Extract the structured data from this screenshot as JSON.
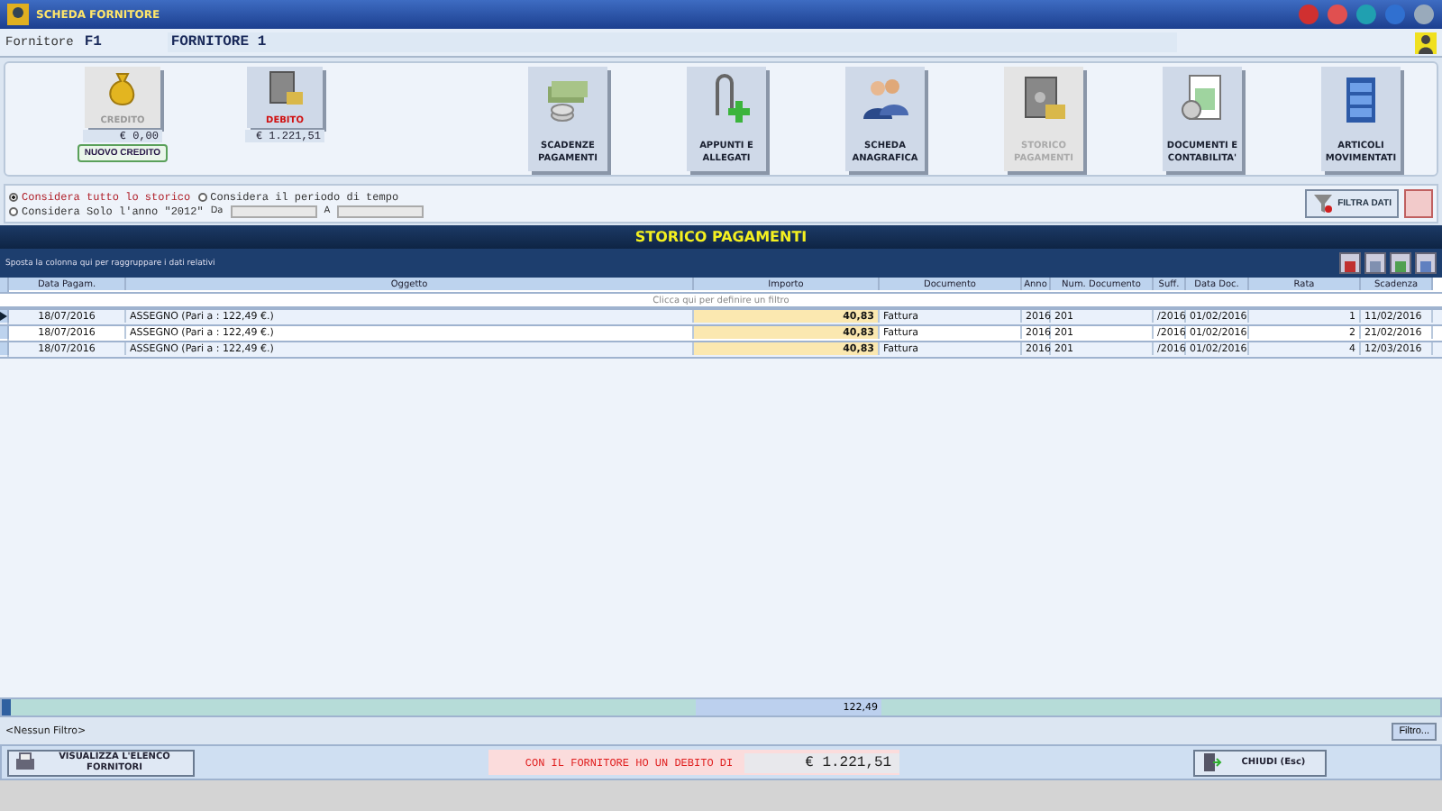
{
  "window": {
    "title": "SCHEDA FORNITORE"
  },
  "header": {
    "label": "Fornitore",
    "code": "F1",
    "name": "FORNITORE 1"
  },
  "toolbar": {
    "credit": {
      "label": "CREDITO",
      "amount": "€ 0,00",
      "action": "NUOVO CREDITO"
    },
    "debit": {
      "label": "DEBITO",
      "amount": "€ 1.221,51"
    },
    "buttons": [
      {
        "label": "SCADENZE PAGAMENTI",
        "selected": false
      },
      {
        "label": "APPUNTI E ALLEGATI",
        "selected": false
      },
      {
        "label": "SCHEDA ANAGRAFICA",
        "selected": false
      },
      {
        "label": "STORICO PAGAMENTI",
        "selected": true
      },
      {
        "label": "DOCUMENTI E CONTABILITA'",
        "selected": false
      },
      {
        "label": "ARTICOLI MOVIMENTATI",
        "selected": false
      }
    ]
  },
  "filters": {
    "options": [
      {
        "label": "Considera tutto lo storico",
        "selected": true
      },
      {
        "label": "Considera il periodo di tempo",
        "selected": false
      },
      {
        "label": "Considera Solo l'anno \"2012\"",
        "selected": false
      }
    ],
    "from_label": "Da",
    "to_label": "A",
    "filter_button": "FILTRA DATI"
  },
  "grid": {
    "title": "STORICO PAGAMENTI",
    "group_hint": "Sposta la colonna qui per raggruppare i dati relativi",
    "columns": [
      "Data Pagam.",
      "Oggetto",
      "Importo",
      "Documento",
      "Anno",
      "Num. Documento",
      "Suff.",
      "Data Doc.",
      "Rata",
      "Scadenza"
    ],
    "filter_hint": "Clicca qui per definire un filtro",
    "rows": [
      {
        "selected": true,
        "cells": [
          "18/07/2016",
          "ASSEGNO (Pari a : 122,49 €.)",
          "40,83",
          "Fattura",
          "2016",
          "201",
          "/2016",
          "01/02/2016",
          "1",
          "11/02/2016"
        ]
      },
      {
        "selected": false,
        "cells": [
          "18/07/2016",
          "ASSEGNO (Pari a : 122,49 €.)",
          "40,83",
          "Fattura",
          "2016",
          "201",
          "/2016",
          "01/02/2016",
          "2",
          "21/02/2016"
        ]
      },
      {
        "selected": false,
        "cells": [
          "18/07/2016",
          "ASSEGNO (Pari a : 122,49 €.)",
          "40,83",
          "Fattura",
          "2016",
          "201",
          "/2016",
          "01/02/2016",
          "4",
          "12/03/2016"
        ]
      }
    ],
    "total": "122,49",
    "filter_status": "<Nessun Filtro>",
    "filter_button": "Filtro..."
  },
  "footer": {
    "list_button": "VISUALIZZA L'ELENCO FORNITORI",
    "debt_message": "CON IL FORNITORE HO UN DEBITO DI",
    "debt_amount": "€ 1.221,51",
    "close_button": "CHIUDI (Esc)"
  }
}
